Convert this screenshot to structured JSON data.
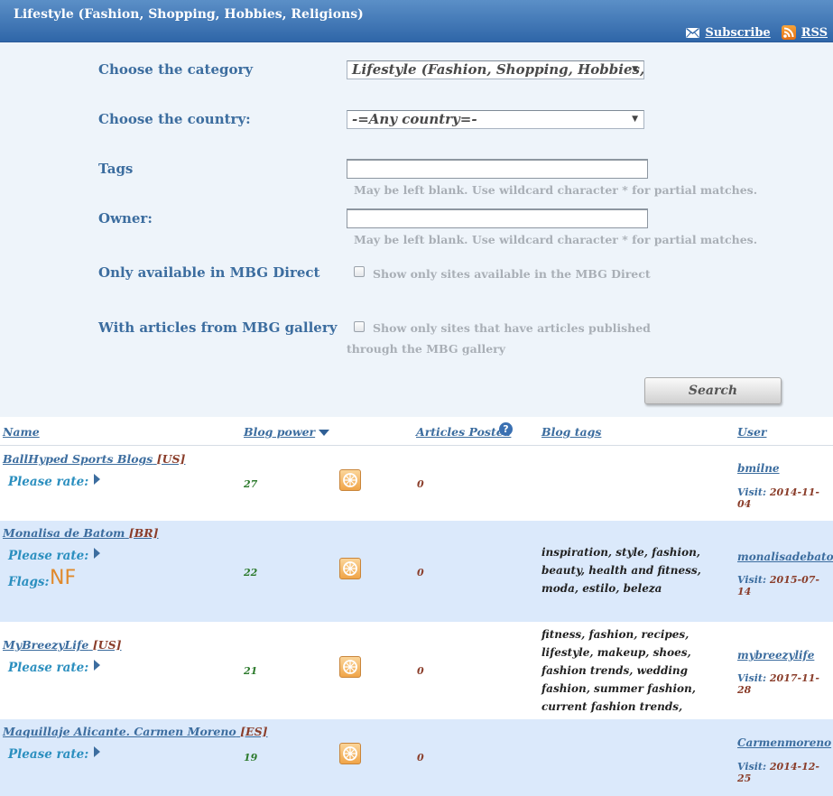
{
  "header": {
    "title": "Lifestyle (Fashion, Shopping, Hobbies, Religions)",
    "subscribe": "Subscribe",
    "rss": "RSS"
  },
  "form": {
    "category_label": "Choose the category",
    "category_value": "Lifestyle (Fashion, Shopping, Hobbies, Religions)",
    "country_label": "Choose the country:",
    "country_value": "-=Any country=-",
    "tags_label": "Tags",
    "tags_hint": "May be left blank. Use wildcard character * for partial matches.",
    "owner_label": "Owner:",
    "owner_hint": "May be left blank. Use wildcard character * for partial matches.",
    "direct_label": "Only available in MBG Direct",
    "direct_checkbox": "Show only sites available in the MBG Direct",
    "gallery_label": "With articles from MBG gallery",
    "gallery_checkbox_line1": "Show only sites that have articles published",
    "gallery_checkbox_line2": "through the MBG gallery",
    "search_button": "Search"
  },
  "table": {
    "headers": {
      "name": "Name",
      "blog_power": "Blog power",
      "articles": "Articles Posted",
      "tags": "Blog tags",
      "user": "User"
    },
    "rate_label": "Please rate:",
    "flags_label": "Flags:",
    "visit_label": "Visit:",
    "rows": [
      {
        "name": "BallHyped Sports Blogs",
        "country": "[US]",
        "power": "27",
        "articles": "0",
        "tags": "",
        "user": "bmilne",
        "visit": "2014-11-04"
      },
      {
        "name": "Monalisa de Batom",
        "country": "[BR]",
        "flag": "NF",
        "power": "22",
        "articles": "0",
        "tags": "inspiration, style, fashion, beauty, health and fitness, moda, estilo, beleza",
        "user": "monalisadebatom",
        "visit": "2015-07-14"
      },
      {
        "name": "MyBreezyLife",
        "country": "[US]",
        "power": "21",
        "articles": "0",
        "tags": "fitness, fashion, recipes, lifestyle, makeup, shoes, fashion trends, wedding fashion, summer fashion, current fashion trends, beauty tips and tricks",
        "user": "mybreezylife",
        "visit": "2017-11-28"
      },
      {
        "name": "Maquillaje Alicante. Carmen Moreno",
        "country": "[ES]",
        "power": "19",
        "articles": "0",
        "tags": "",
        "user": "Carmenmoreno",
        "visit": "2014-12-25"
      }
    ]
  }
}
